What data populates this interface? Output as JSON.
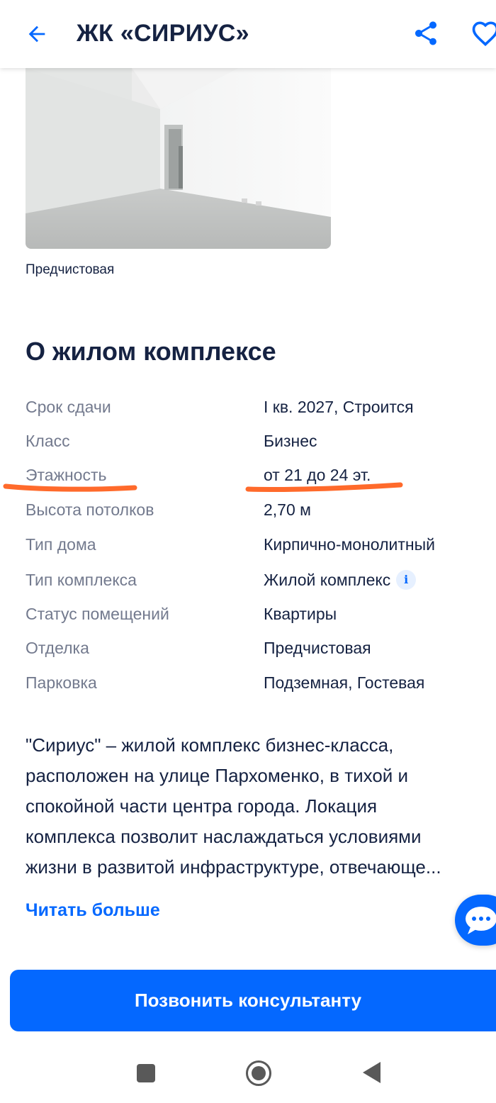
{
  "header": {
    "title": "ЖК «СИРИУС»"
  },
  "photo": {
    "caption": "Предчистовая"
  },
  "about": {
    "title": "О жилом комплексе",
    "specs": [
      {
        "label": "Срок сдачи",
        "value": "I кв. 2027, Строится"
      },
      {
        "label": "Класс",
        "value": "Бизнес"
      },
      {
        "label": "Этажность",
        "value": "от 21 до 24 эт."
      },
      {
        "label": "Высота потолков",
        "value": "2,70 м"
      },
      {
        "label": "Тип дома",
        "value": "Кирпично-монолитный"
      },
      {
        "label": "Тип комплекса",
        "value": "Жилой комплекс"
      },
      {
        "label": "Статус помещений",
        "value": "Квартиры"
      },
      {
        "label": "Отделка",
        "value": "Предчистовая"
      },
      {
        "label": "Парковка",
        "value": "Подземная, Гостевая"
      }
    ],
    "info_icon": "i",
    "description_lines": [
      "\"Сириус\" – жилой комплекс бизнес-класса,",
      "расположен на улице Пархоменко, в тихой и",
      "спокойной части центра города. Локация",
      "комплекса позволит наслаждаться условиями",
      "жизни в развитой инфраструктуре, отвечающе..."
    ],
    "read_more": "Читать больше"
  },
  "cta": {
    "call_label": "Позвонить консультанту"
  },
  "colors": {
    "accent": "#0468ff",
    "text_primary": "#152242",
    "text_secondary": "#737a8e",
    "highlight_stroke": "#ff6a2b"
  }
}
